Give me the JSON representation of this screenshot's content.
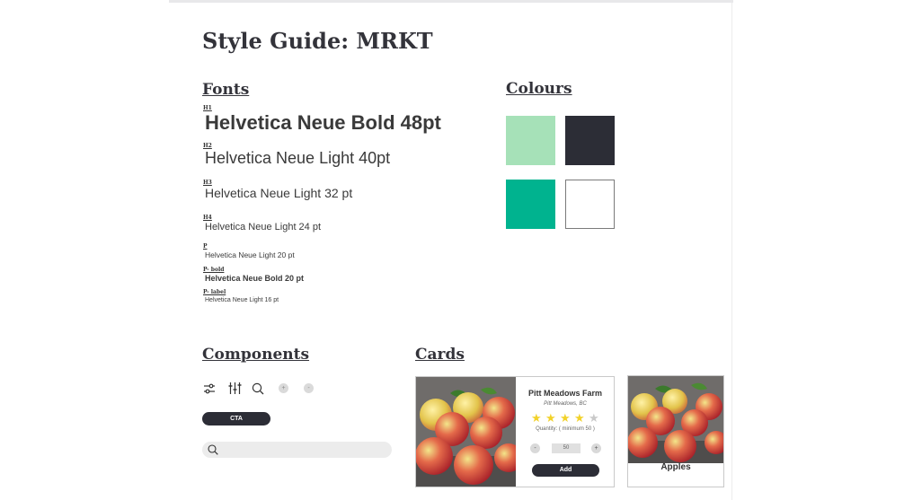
{
  "page": {
    "title": "Style Guide: MRKT"
  },
  "fonts": {
    "heading": "Fonts",
    "samples": [
      {
        "tag": "H1",
        "text": "Helvetica Neue Bold 48pt"
      },
      {
        "tag": "H2",
        "text": "Helvetica Neue Light 40pt"
      },
      {
        "tag": "H3",
        "text": "Helvetica Neue Light 32 pt"
      },
      {
        "tag": "H4",
        "text": "Helvetica Neue Light 24 pt"
      },
      {
        "tag": "P",
        "text": "Helvetica Neue Light 20 pt"
      },
      {
        "tag": "P- bold",
        "text": "Helvetica Neue Bold 20 pt"
      },
      {
        "tag": "P- label",
        "text": "Helvetica Neue Light 16 pt"
      }
    ]
  },
  "colours": {
    "heading": "Colours",
    "swatches": [
      "#a6e1b8",
      "#2c2d36",
      "#00b38f",
      "#ffffff"
    ]
  },
  "components": {
    "heading": "Components",
    "icons": [
      "filter-icon",
      "equalizer-icon",
      "search-icon",
      "plus-icon",
      "minus-icon"
    ],
    "cta_label": "CTA",
    "search_icon": "search-icon"
  },
  "cards": {
    "heading": "Cards",
    "farm_card": {
      "title": "Pitt Meadows Farm",
      "location": "Pitt Meadows, BC",
      "rating": 4,
      "max_rating": 5,
      "quantity_label": "Quantity: ( minimum 50 )",
      "quantity_value": "50",
      "minus": "-",
      "plus": "+",
      "add_label": "Add"
    },
    "product_card": {
      "label": "Apples"
    }
  }
}
